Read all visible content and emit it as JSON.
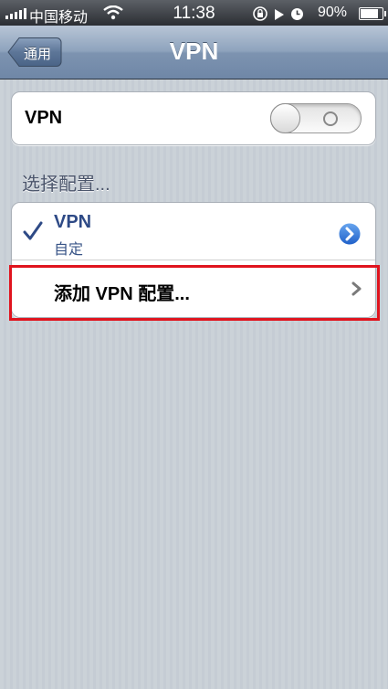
{
  "status_bar": {
    "carrier": "中国移动",
    "time": "11:38",
    "battery_percent": "90%",
    "battery_level": 0.9,
    "icons": [
      "signal-icon",
      "wifi-icon",
      "rotation-lock-icon",
      "play-icon",
      "alarm-icon",
      "battery-icon"
    ]
  },
  "nav": {
    "title": "VPN",
    "back_label": "通用"
  },
  "vpn_switch": {
    "label": "VPN",
    "state": "off"
  },
  "section": {
    "label": "选择配置..."
  },
  "configs": [
    {
      "name": "VPN",
      "subtitle": "自定",
      "selected": true
    }
  ],
  "add_config": {
    "label": "添加 VPN 配置..."
  },
  "colors": {
    "highlight": "#e0141e",
    "selected_text": "#2e4a86",
    "detail_button": "#2f6fd8"
  }
}
